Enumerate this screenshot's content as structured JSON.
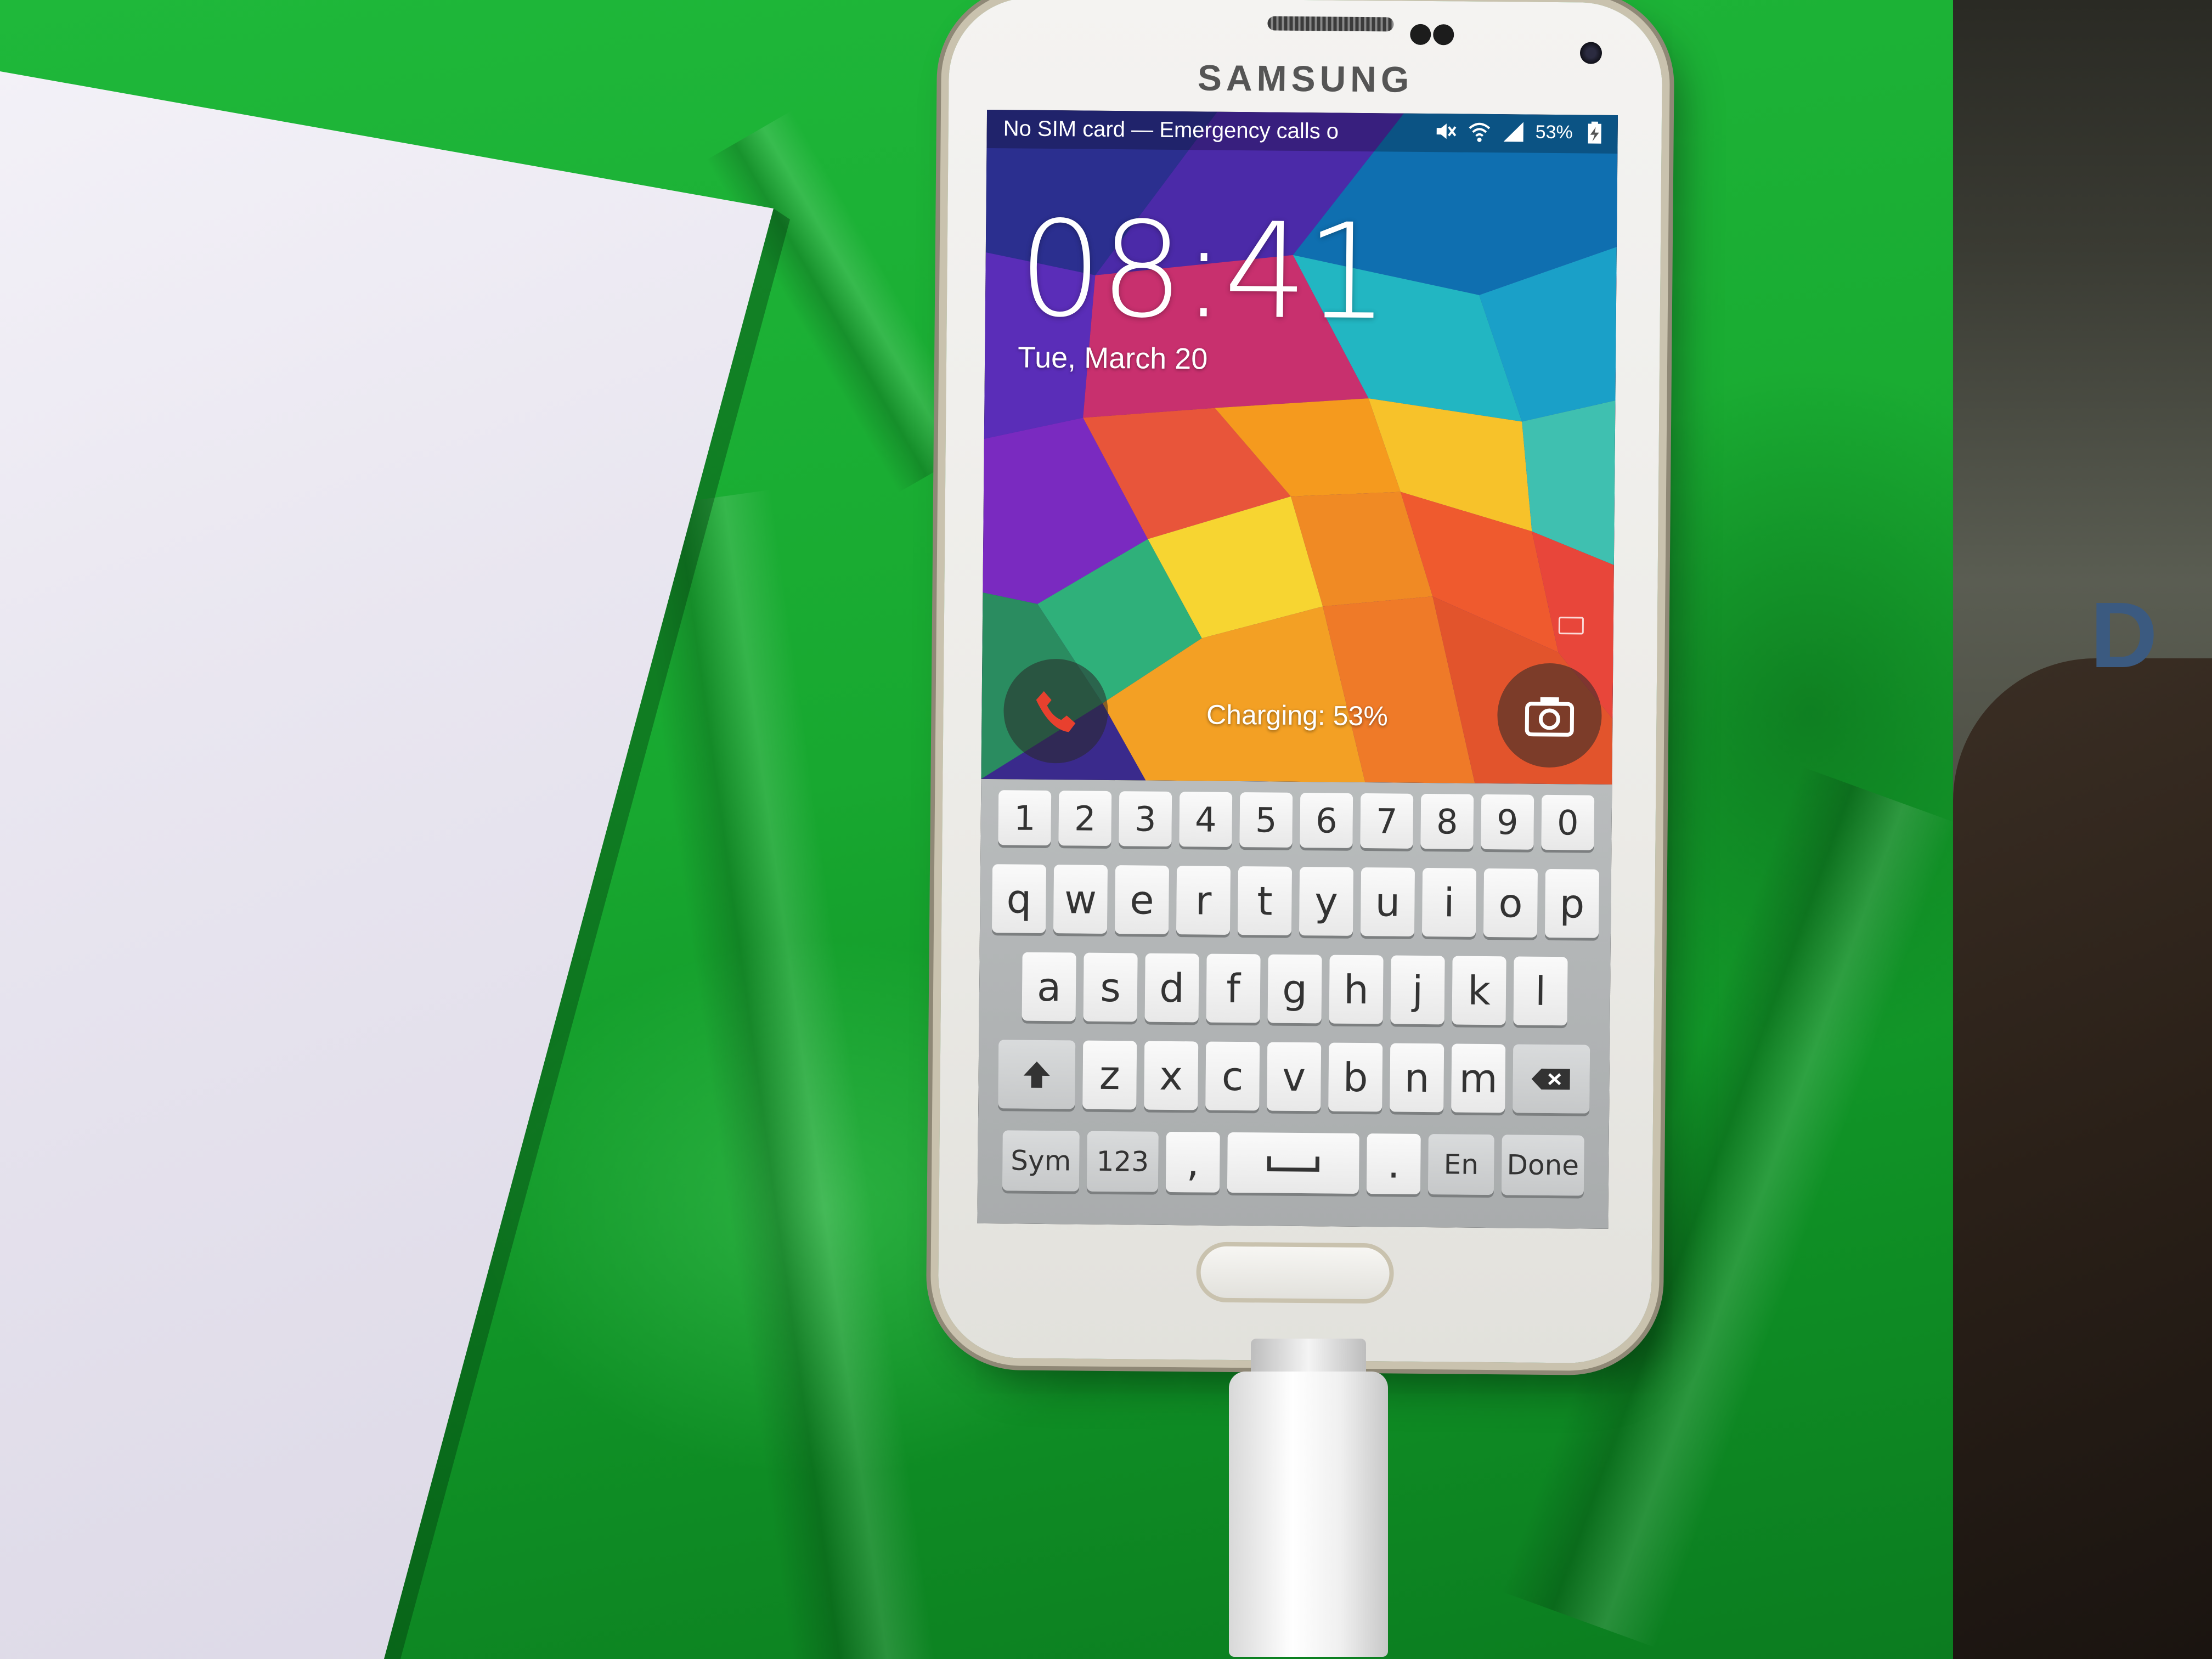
{
  "phone": {
    "brand": "SAMSUNG",
    "status_bar": {
      "carrier_text": "No SIM card — Emergency calls o",
      "battery_text": "53%",
      "icons": [
        "mute-icon",
        "wifi-icon",
        "signal-icon",
        "battery-charging-icon"
      ]
    },
    "lock_screen": {
      "time": "08:41",
      "date": "Tue, March 20",
      "charging_text": "Charging: 53%",
      "shortcut_left_icon": "phone-icon",
      "shortcut_right_icon": "camera-icon"
    },
    "keyboard": {
      "number_row": [
        "1",
        "2",
        "3",
        "4",
        "5",
        "6",
        "7",
        "8",
        "9",
        "0"
      ],
      "row1": [
        "q",
        "w",
        "e",
        "r",
        "t",
        "y",
        "u",
        "i",
        "o",
        "p"
      ],
      "row2": [
        "a",
        "s",
        "d",
        "f",
        "g",
        "h",
        "j",
        "k",
        "l"
      ],
      "row3": [
        "z",
        "x",
        "c",
        "v",
        "b",
        "n",
        "m"
      ],
      "sym_label": "Sym",
      "num_label": "123",
      "comma_label": ",",
      "period_label": ".",
      "lang_label": "En",
      "done_label": "Done",
      "shift_icon": "shift-arrow-icon",
      "backspace_icon": "backspace-icon",
      "space_icon": "spacebar-icon"
    }
  },
  "colors": {
    "background_green": "#18a830",
    "phone_white": "#f0efeb",
    "bezel_gold": "#c9c2ae",
    "keyboard_gray": "#b3b6b7"
  },
  "side_fabric": {
    "letter": "D"
  }
}
